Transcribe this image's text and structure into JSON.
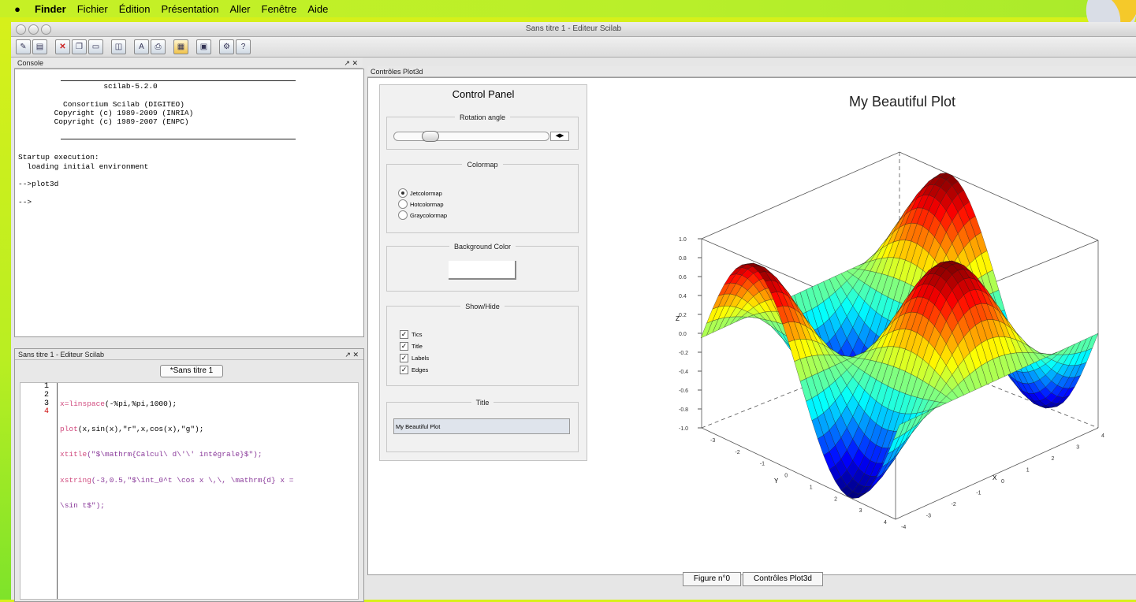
{
  "menubar": {
    "app": "Finder",
    "items": [
      "Fichier",
      "Édition",
      "Présentation",
      "Aller",
      "Fenêtre",
      "Aide"
    ]
  },
  "window": {
    "title": "Sans titre 1 - Editeur Scilab"
  },
  "console": {
    "header": "Console",
    "lines": [
      "                   scilab-5.2.0",
      "",
      "          Consortium Scilab (DIGITEO)",
      "        Copyright (c) 1989-2009 (INRIA)",
      "        Copyright (c) 1989-2007 (ENPC)",
      "",
      "",
      "",
      "Startup execution:",
      "  loading initial environment",
      "",
      "-->plot3d",
      "",
      "-->"
    ]
  },
  "editor": {
    "header": "Sans titre 1 - Editeur Scilab",
    "tab": "*Sans titre 1",
    "line_numbers": [
      "1",
      "2",
      "3",
      "4"
    ],
    "code": [
      {
        "kw": "x=linspace",
        "rest": "(-%pi,%pi,1000);"
      },
      {
        "kw": "plot",
        "rest": "(x,sin(x),\"r\",x,cos(x),\"g\");"
      },
      {
        "kw": "xtitle",
        "rest": "(\"$\\mathrm{Calcul\\ d\\'\\' intégrale}$\");"
      },
      {
        "kw": "xstring",
        "rest": "(-3,0.5,\"$\\int_0^t \\cos x \\,\\, \\mathrm{d} x ="
      },
      {
        "kw": "",
        "rest": "\\sin t$\");"
      }
    ]
  },
  "controls": {
    "header": "Contrôles Plot3d",
    "panel_title": "Control Panel",
    "rotation": {
      "label": "Rotation angle",
      "value": 0.2
    },
    "colormap": {
      "label": "Colormap",
      "options": [
        "Jetcolormap",
        "Hotcolormap",
        "Graycolormap"
      ],
      "selected": 0
    },
    "background": {
      "label": "Background Color"
    },
    "showhide": {
      "label": "Show/Hide",
      "items": [
        "Tics",
        "Title",
        "Labels",
        "Edges"
      ]
    },
    "title_group": {
      "label": "Title",
      "value": "My Beautiful Plot"
    }
  },
  "plot": {
    "title": "My Beautiful Plot",
    "z_label": "Z",
    "x_label": "X",
    "y_label": "Y",
    "z_ticks": [
      "1.0",
      "0.8",
      "0.6",
      "0.4",
      "0.2",
      "0.0",
      "-0.2",
      "-0.4",
      "-0.6",
      "-0.8",
      "-1.0"
    ],
    "x_ticks": [
      "-4",
      "-3",
      "-2",
      "-1",
      "0",
      "1",
      "2",
      "3",
      "4"
    ],
    "y_ticks": [
      "-3",
      "-2",
      "-1",
      "0",
      "1",
      "2",
      "3",
      "4"
    ]
  },
  "footer_tabs": [
    "Figure n°0",
    "Contrôles Plot3d"
  ]
}
